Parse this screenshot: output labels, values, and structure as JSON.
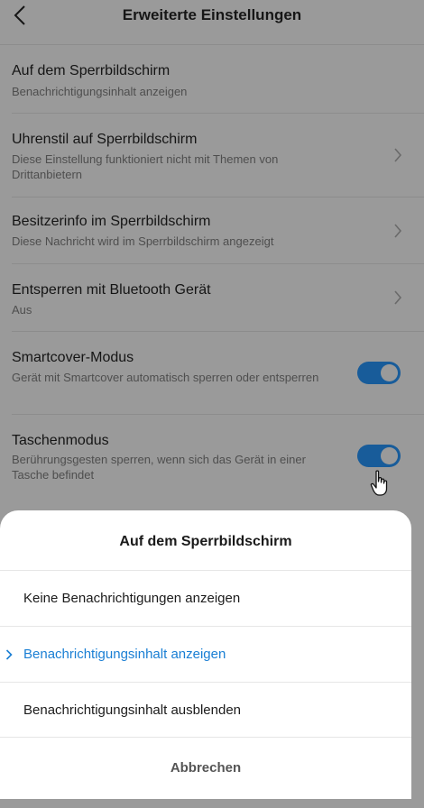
{
  "header": {
    "title": "Erweiterte Einstellungen",
    "back_icon": "chevron-left-icon"
  },
  "settings": [
    {
      "title": "Auf dem Sperrbildschirm",
      "subtitle": "Benachrichtigungsinhalt anzeigen",
      "control": "none"
    },
    {
      "title": "Uhrenstil auf Sperrbildschirm",
      "subtitle": "Diese Einstellung funktioniert nicht mit Themen von Drittanbietern",
      "control": "chevron"
    },
    {
      "title": "Besitzerinfo im Sperrbildschirm",
      "subtitle": "Diese Nachricht wird im Sperrbildschirm angezeigt",
      "control": "chevron"
    },
    {
      "title": "Entsperren mit Bluetooth Gerät",
      "subtitle": "Aus",
      "control": "chevron"
    },
    {
      "title": "Smartcover-Modus",
      "subtitle": "Gerät mit Smartcover automatisch sperren oder entsperren",
      "control": "toggle",
      "enabled": true
    },
    {
      "title": "Taschenmodus",
      "subtitle": "Berührungsgesten sperren, wenn sich das Gerät in einer Tasche befindet",
      "control": "toggle",
      "enabled": true
    }
  ],
  "sheet": {
    "title": "Auf dem Sperrbildschirm",
    "options": [
      {
        "label": "Keine Benachrichtigungen anzeigen",
        "selected": false
      },
      {
        "label": "Benachrichtigungsinhalt anzeigen",
        "selected": true
      },
      {
        "label": "Benachrichtigungsinhalt ausblenden",
        "selected": false
      }
    ],
    "cancel_label": "Abbrechen"
  },
  "colors": {
    "accent": "#1a7fd4",
    "toggle_on_dimmed": "#185c9a",
    "overlay_background": "#9a9a9a",
    "sheet_background": "#ffffff"
  }
}
